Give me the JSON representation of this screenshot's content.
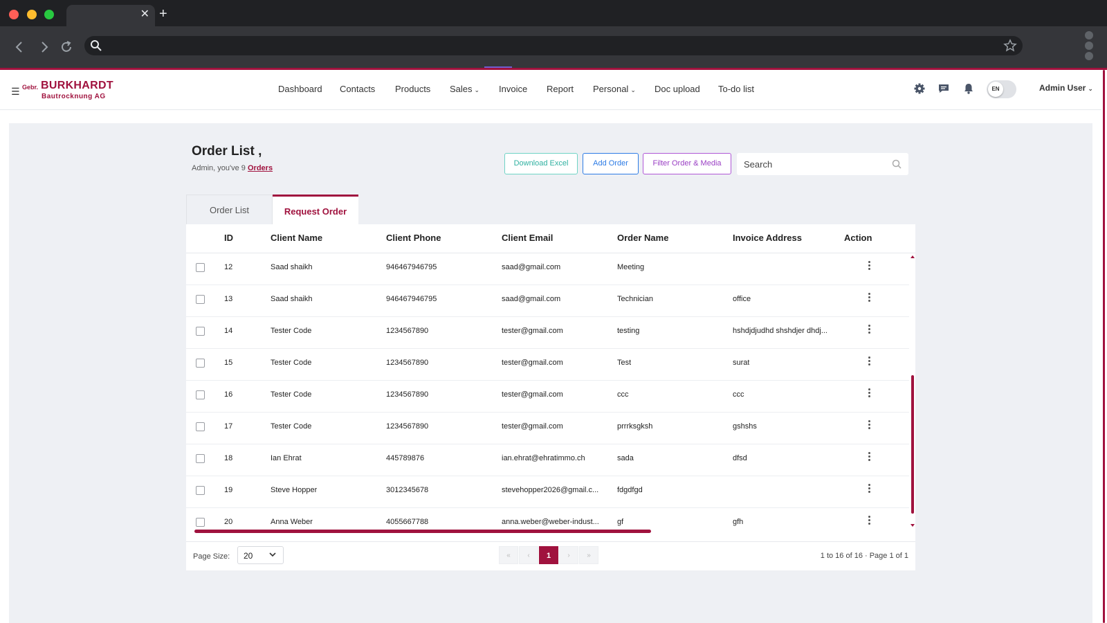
{
  "browser": {
    "tab_close": "✕",
    "new_tab": "+"
  },
  "app": {
    "logo_prefix": "Gebr.",
    "logo_name": "BURKHARDT",
    "logo_sub": "Bautrocknung AG",
    "brand_color": "#a0123e",
    "nav": [
      {
        "label": "Dashboard",
        "has_caret": false
      },
      {
        "label": "Contacts",
        "has_caret": false
      },
      {
        "label": "Products",
        "has_caret": false
      },
      {
        "label": "Sales",
        "has_caret": true
      },
      {
        "label": "Invoice",
        "has_caret": false
      },
      {
        "label": "Report",
        "has_caret": false
      },
      {
        "label": "Personal",
        "has_caret": true
      },
      {
        "label": "Doc upload",
        "has_caret": false
      },
      {
        "label": "To-do list",
        "has_caret": false
      }
    ],
    "header_icons": [
      "gear-icon",
      "chat-icon",
      "bell-icon"
    ],
    "language": "EN",
    "user": "Admin User"
  },
  "page": {
    "title": "Order List ,",
    "subtitle_prefix": "Admin, you've 9 ",
    "subtitle_link": "Orders",
    "buttons": {
      "download_excel": "Download Excel",
      "add_order": "Add Order",
      "filter": "Filter Order & Media"
    },
    "search_placeholder": "Search",
    "tabs": {
      "order_list": "Order List",
      "request_order": "Request Order"
    }
  },
  "table": {
    "columns": [
      "ID",
      "Client Name",
      "Client Phone",
      "Client Email",
      "Order Name",
      "Invoice Address",
      "Action"
    ],
    "rows": [
      {
        "id": "12",
        "client_name": "Saad shaikh",
        "phone": "946467946795",
        "email": "saad@gmail.com",
        "order_name": "Meeting",
        "invoice_address": ""
      },
      {
        "id": "13",
        "client_name": "Saad shaikh",
        "phone": "946467946795",
        "email": "saad@gmail.com",
        "order_name": "Technician",
        "invoice_address": "office"
      },
      {
        "id": "14",
        "client_name": "Tester Code",
        "phone": "1234567890",
        "email": "tester@gmail.com",
        "order_name": "testing",
        "invoice_address": "hshdjdjudhd shshdjer dhdj..."
      },
      {
        "id": "15",
        "client_name": "Tester Code",
        "phone": "1234567890",
        "email": "tester@gmail.com",
        "order_name": "Test",
        "invoice_address": "surat"
      },
      {
        "id": "16",
        "client_name": "Tester Code",
        "phone": "1234567890",
        "email": "tester@gmail.com",
        "order_name": "ccc",
        "invoice_address": "ccc"
      },
      {
        "id": "17",
        "client_name": "Tester Code",
        "phone": "1234567890",
        "email": "tester@gmail.com",
        "order_name": "prrrksgksh",
        "invoice_address": "gshshs"
      },
      {
        "id": "18",
        "client_name": "Ian Ehrat",
        "phone": "445789876",
        "email": "ian.ehrat@ehratimmo.ch",
        "order_name": "sada",
        "invoice_address": "dfsd"
      },
      {
        "id": "19",
        "client_name": "Steve Hopper",
        "phone": "3012345678",
        "email": "stevehopper2026@gmail.c...",
        "order_name": "fdgdfgd",
        "invoice_address": ""
      },
      {
        "id": "20",
        "client_name": "Anna Weber",
        "phone": "4055667788",
        "email": "anna.weber@weber-indust...",
        "order_name": "gf",
        "invoice_address": "gfh"
      }
    ]
  },
  "footer": {
    "page_size_label": "Page Size:",
    "page_size_value": "20",
    "pager": [
      "«",
      "‹",
      "1",
      "›",
      "»"
    ],
    "summary": "1 to 16 of 16 · Page 1 of 1"
  }
}
